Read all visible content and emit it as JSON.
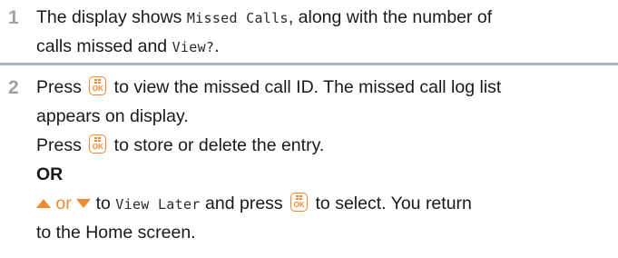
{
  "steps": [
    {
      "number": "1",
      "line1": {
        "t1": "The display shows ",
        "code1": "Missed Calls",
        "t2": ", along with the number of"
      },
      "line2": {
        "t1": "calls missed and ",
        "code1": "View?",
        "t2": "."
      }
    },
    {
      "number": "2",
      "line1": {
        "t1": "Press ",
        "t2": " to view the missed call ID. The missed call log list"
      },
      "line2": "appears on display.",
      "line3": {
        "t1": "Press ",
        "t2": " to store or delete the entry."
      },
      "line4": "OR",
      "line5": {
        "or": " or ",
        "t1": " to ",
        "code1": "View Later",
        "t2": " and press ",
        "t3": " to select. You return"
      },
      "line6": "to the Home screen."
    }
  ],
  "icons": {
    "ok_key": "ok-key-icon",
    "ok_key_label": "OK",
    "up_arrow": "up-arrow-icon",
    "down_arrow": "down-arrow-icon"
  },
  "colors": {
    "accent": "#f08a30",
    "step_number": "#9aa3ab",
    "divider": "#a7b5c2",
    "text": "#1a1a1a"
  }
}
